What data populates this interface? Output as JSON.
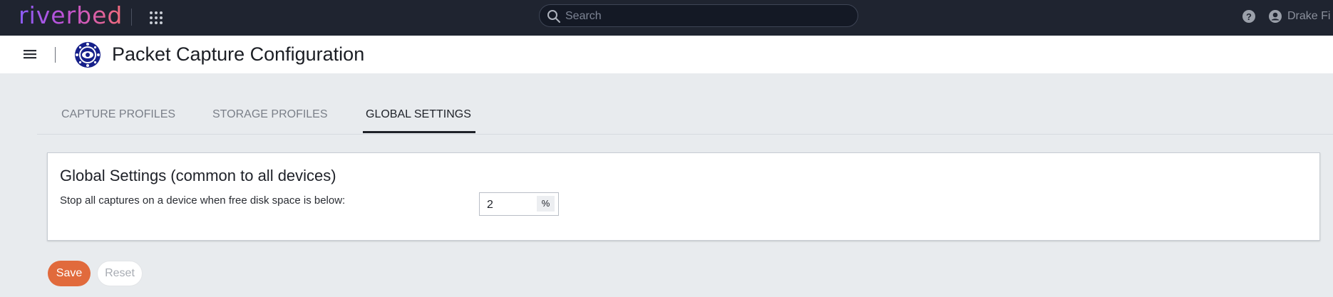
{
  "topbar": {
    "logo_text": "riverbed",
    "search_placeholder": "Search",
    "user_name": "Drake Fi",
    "icons": [
      "apps-grid-icon",
      "search-icon",
      "help-icon",
      "user-icon"
    ]
  },
  "header": {
    "title": "Packet Capture Configuration",
    "icons": [
      "menu-icon",
      "app-logo-icon"
    ]
  },
  "tabs": [
    {
      "label": "CAPTURE PROFILES",
      "active": false
    },
    {
      "label": "STORAGE PROFILES",
      "active": false
    },
    {
      "label": "GLOBAL SETTINGS",
      "active": true
    }
  ],
  "global_settings": {
    "title": "Global Settings (common to all devices)",
    "disk_threshold_label": "Stop all captures on a device when free disk space is below:",
    "disk_threshold_value": "2",
    "disk_threshold_unit": "%"
  },
  "actions": {
    "save_label": "Save",
    "reset_label": "Reset"
  },
  "colors": {
    "topbar_bg": "#1f2430",
    "accent_orange": "#e16a3c",
    "page_bg": "#e8ebee"
  }
}
